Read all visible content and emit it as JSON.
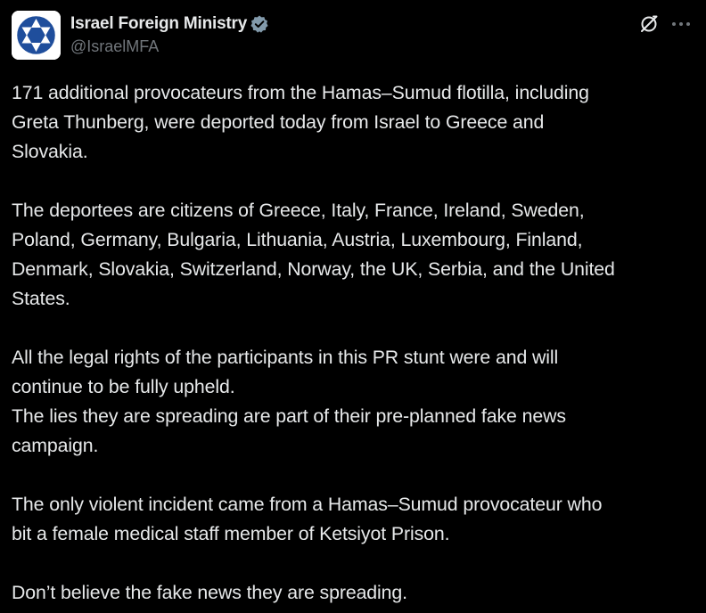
{
  "author": {
    "display_name": "Israel Foreign Ministry",
    "handle": "@IsraelMFA",
    "verified_color": "#829aab",
    "avatar_icon": "star-of-david-logo"
  },
  "actions": {
    "grok_icon": "grok-icon",
    "more_icon": "more-icon"
  },
  "post": {
    "paragraphs": [
      {
        "lines": [
          "171 additional provocateurs from the Hamas–Sumud flotilla, including",
          "Greta Thunberg, were deported today from Israel to Greece and",
          "Slovakia."
        ]
      },
      {
        "lines": [
          "The deportees are citizens of Greece, Italy, France, Ireland, Sweden,",
          "Poland, Germany, Bulgaria, Lithuania, Austria, Luxembourg, Finland,",
          "Denmark, Slovakia, Switzerland, Norway, the UK, Serbia, and the United",
          "States."
        ]
      },
      {
        "lines": [
          "All the legal rights of the participants in this PR stunt were and will",
          "continue to be fully upheld.",
          "The lies they are spreading are part of their pre-planned fake news",
          "campaign."
        ]
      },
      {
        "lines": [
          "The only violent incident came from a Hamas–Sumud provocateur who",
          "bit a female medical staff member of Ketsiyot Prison."
        ]
      },
      {
        "lines": [
          "Don’t believe the fake news they are spreading."
        ]
      }
    ]
  },
  "colors": {
    "background": "#000000",
    "text": "#e7e9ea",
    "secondary_text": "#71767b",
    "brand_blue": "#1f4e9c"
  }
}
